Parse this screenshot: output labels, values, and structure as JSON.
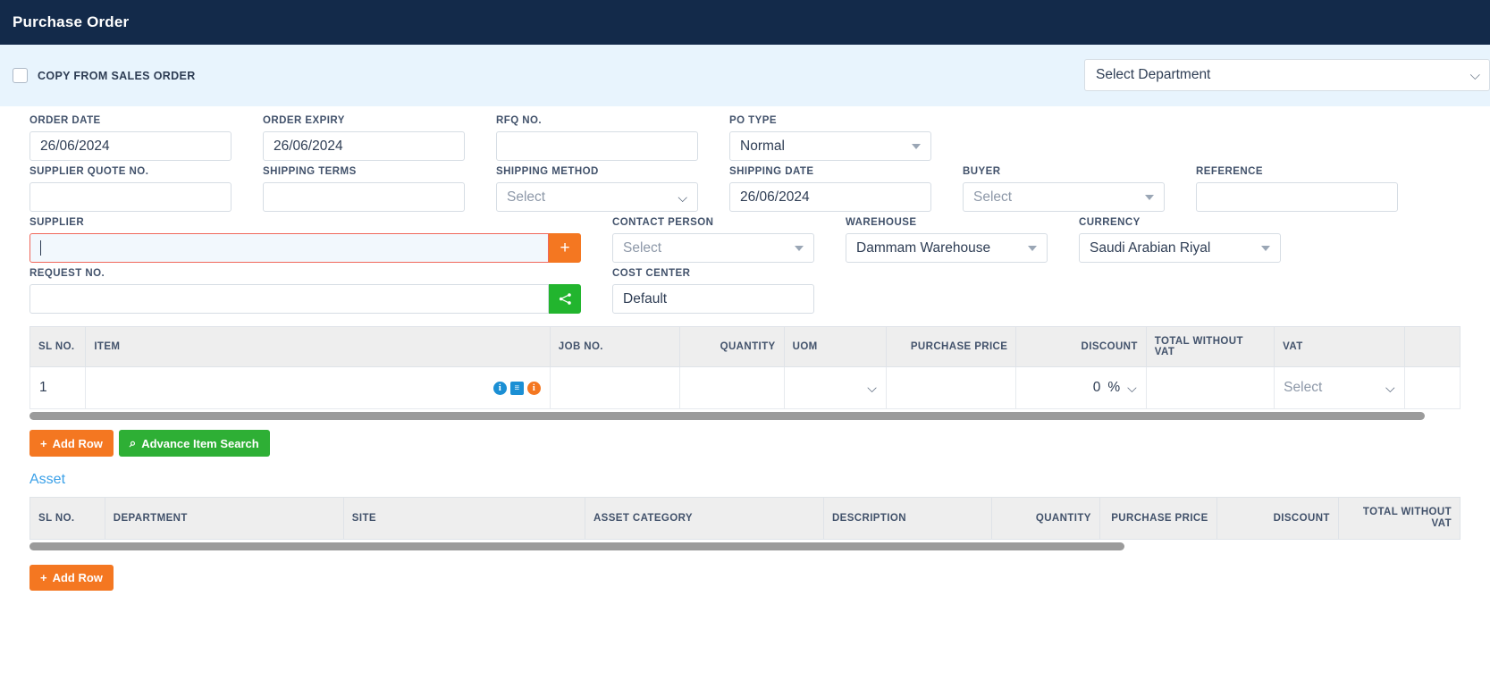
{
  "header": {
    "title": "Purchase Order"
  },
  "top_strip": {
    "copy_from_sales_order": "COPY FROM SALES ORDER",
    "department_value": "Select Department",
    "chevron": "⌄"
  },
  "form": {
    "order_date": {
      "label": "ORDER DATE",
      "value": "26/06/2024"
    },
    "order_expiry": {
      "label": "ORDER EXPIRY",
      "value": "26/06/2024"
    },
    "rfq_no": {
      "label": "RFQ NO.",
      "value": ""
    },
    "po_type": {
      "label": "PO TYPE",
      "value": "Normal"
    },
    "supplier_quote": {
      "label": "SUPPLIER QUOTE NO.",
      "value": ""
    },
    "shipping_terms": {
      "label": "SHIPPING TERMS",
      "value": ""
    },
    "shipping_method": {
      "label": "SHIPPING METHOD",
      "value": "Select"
    },
    "shipping_date": {
      "label": "SHIPPING DATE",
      "value": "26/06/2024"
    },
    "buyer": {
      "label": "BUYER",
      "value": "Select"
    },
    "reference": {
      "label": "REFERENCE",
      "value": ""
    },
    "supplier": {
      "label": "SUPPLIER",
      "value": "",
      "add_button": "+"
    },
    "contact_person": {
      "label": "CONTACT PERSON",
      "value": "Select"
    },
    "warehouse": {
      "label": "WAREHOUSE",
      "value": "Dammam Warehouse"
    },
    "currency": {
      "label": "CURRENCY",
      "value": "Saudi Arabian Riyal"
    },
    "request_no": {
      "label": "REQUEST NO.",
      "value": ""
    },
    "cost_center": {
      "label": "COST CENTER",
      "value": "Default"
    }
  },
  "item_table": {
    "columns": [
      "SL NO.",
      "ITEM",
      "JOB NO.",
      "QUANTITY",
      "UOM",
      "PURCHASE PRICE",
      "DISCOUNT",
      "TOTAL WITHOUT VAT",
      "VAT"
    ],
    "rows": [
      {
        "sl_no": "1",
        "item": "",
        "job_no": "",
        "quantity": "",
        "uom": "",
        "purchase_price": "",
        "discount_value": "0",
        "discount_unit": "%",
        "total_without_vat": "",
        "vat": "Select"
      }
    ],
    "row_icons": [
      "info-circle-blue",
      "note-square-blue",
      "info-circle-orange"
    ]
  },
  "item_buttons": {
    "add_row": "Add Row",
    "add_row_icon": "+",
    "advance_item_search": "Advance Item Search",
    "search_icon": "⌕"
  },
  "asset_section": {
    "title": "Asset",
    "columns": [
      "SL NO.",
      "DEPARTMENT",
      "SITE",
      "ASSET CATEGORY",
      "DESCRIPTION",
      "QUANTITY",
      "PURCHASE PRICE",
      "DISCOUNT",
      "TOTAL WITHOUT VAT"
    ],
    "add_row": "Add Row",
    "add_row_icon": "+"
  },
  "colors": {
    "header_bg": "#132a4a",
    "strip_bg": "#e8f4fd",
    "accent_orange": "#f47721",
    "accent_green": "#2eaf35",
    "error_border": "#f0675a",
    "link_blue": "#3aa0e8"
  }
}
